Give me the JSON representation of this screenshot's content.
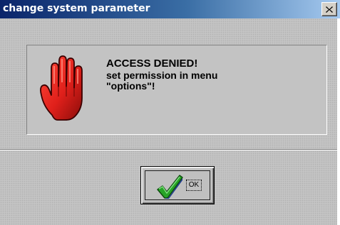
{
  "window": {
    "title": "change system parameter"
  },
  "message": {
    "heading": "ACCESS DENIED!",
    "line1": "set permission in menu",
    "line2": "\"options\"!"
  },
  "buttons": {
    "ok_label": "OK"
  },
  "icons": {
    "close": "close-icon",
    "stop": "stop-hand-icon",
    "ok": "checkmark-icon"
  },
  "colors": {
    "titlebar_start": "#0a246a",
    "titlebar_end": "#a6caf0",
    "hand_red": "#e0201b",
    "check_green": "#27a327",
    "face": "#c4c4c4"
  }
}
